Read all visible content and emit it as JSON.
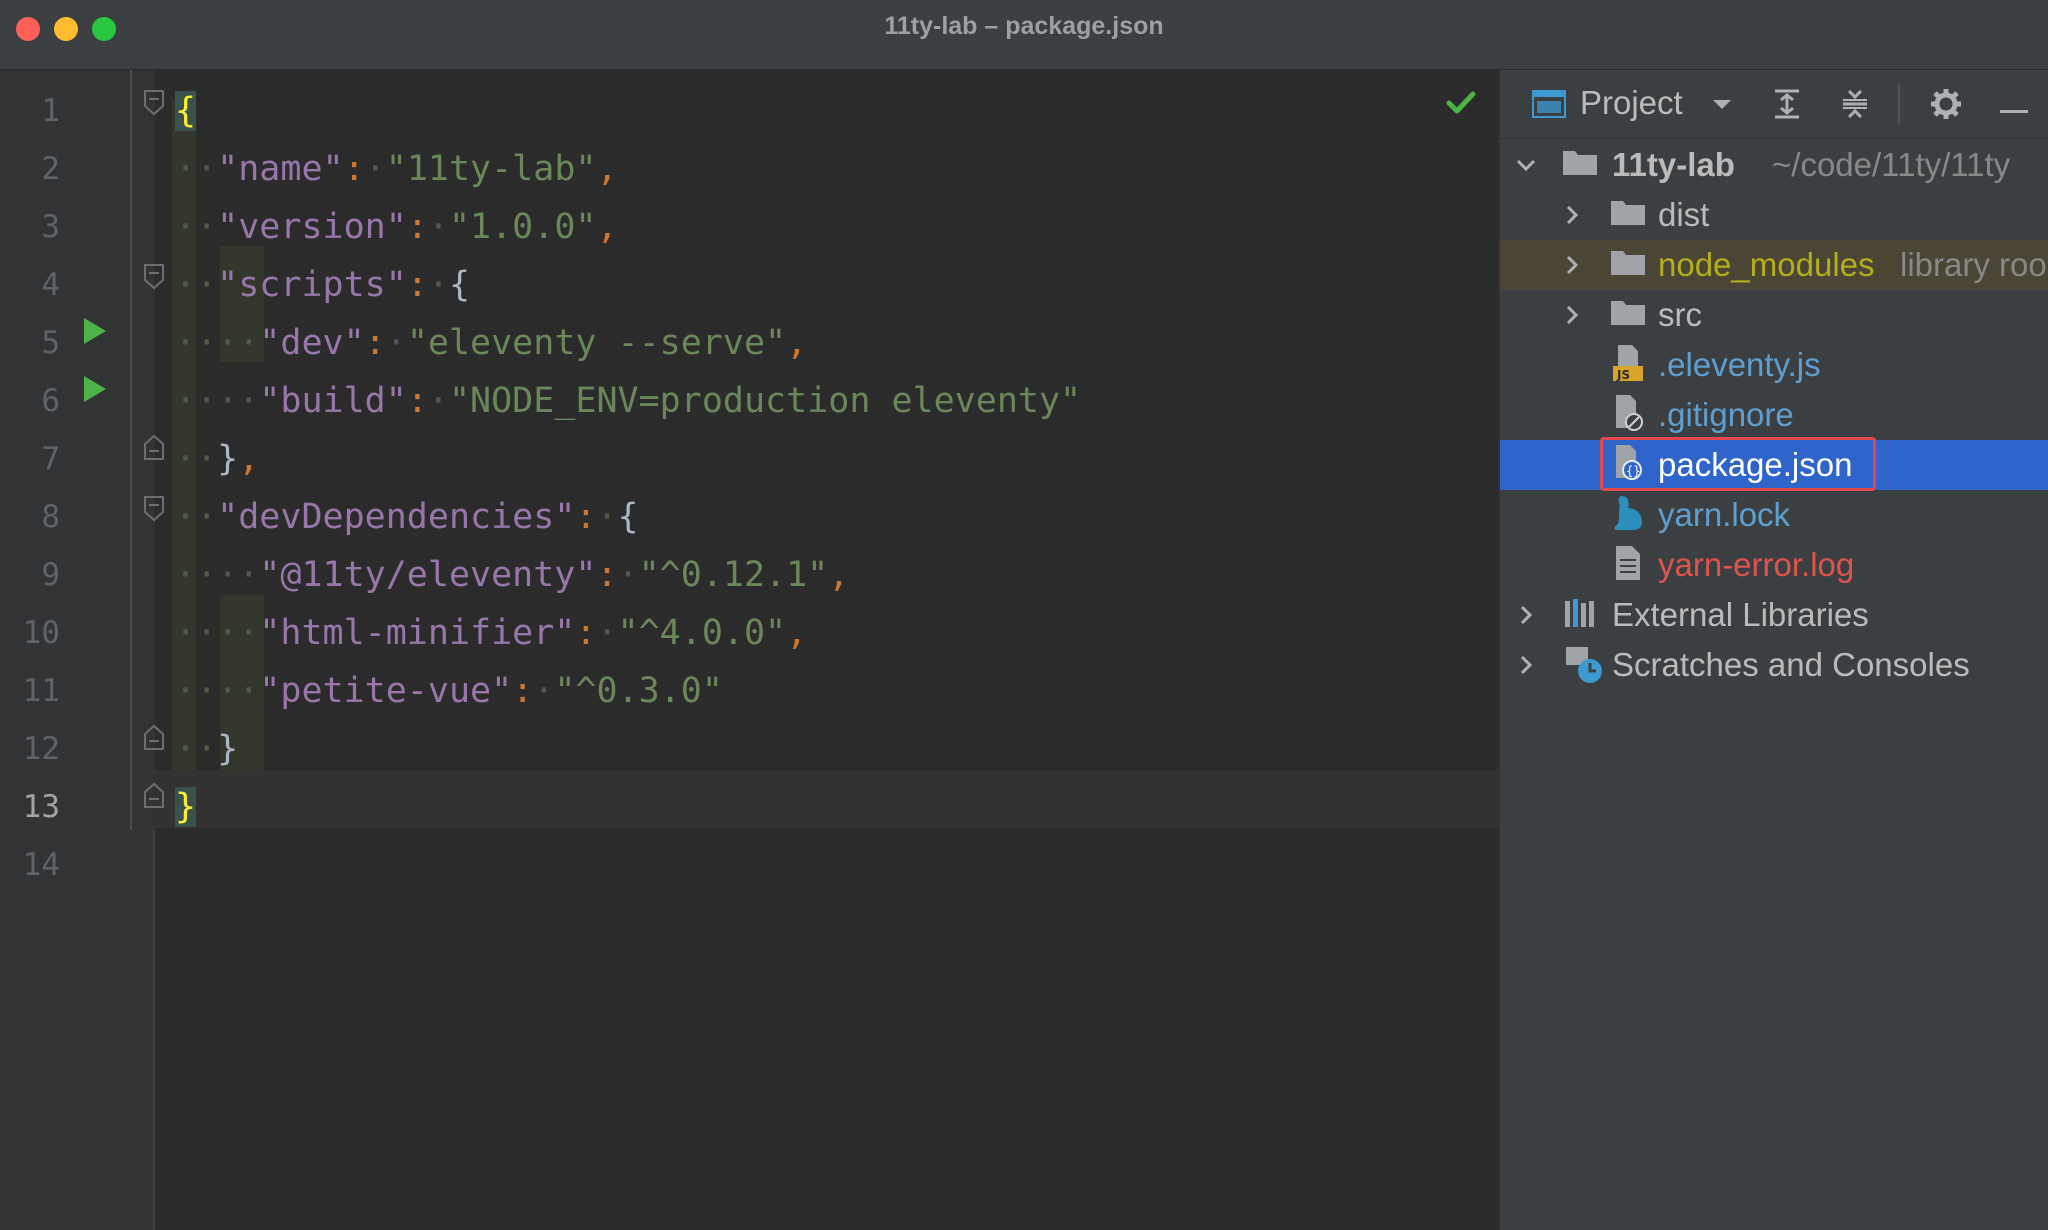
{
  "window": {
    "title": "11ty-lab – package.json"
  },
  "editor": {
    "line_numbers": [
      "1",
      "2",
      "3",
      "4",
      "5",
      "6",
      "7",
      "8",
      "9",
      "10",
      "11",
      "12",
      "13",
      "14"
    ],
    "current_line": "13",
    "code": {
      "l1": {
        "open": "{"
      },
      "l2": {
        "key": "\"name\"",
        "colon": ":",
        "value": "\"11ty-lab\"",
        "comma": ","
      },
      "l3": {
        "key": "\"version\"",
        "colon": ":",
        "value": "\"1.0.0\"",
        "comma": ","
      },
      "l4": {
        "key": "\"scripts\"",
        "colon": ":",
        "open": "{"
      },
      "l5": {
        "key": "\"dev\"",
        "colon": ":",
        "value": "\"eleventy --serve\"",
        "comma": ","
      },
      "l6": {
        "key": "\"build\"",
        "colon": ":",
        "value": "\"NODE_ENV=production eleventy\""
      },
      "l7": {
        "close": "}",
        "comma": ","
      },
      "l8": {
        "key": "\"devDependencies\"",
        "colon": ":",
        "open": "{"
      },
      "l9": {
        "key": "\"@11ty/eleventy\"",
        "colon": ":",
        "value": "\"^0.12.1\"",
        "comma": ","
      },
      "l10": {
        "key": "\"html-minifier\"",
        "colon": ":",
        "value": "\"^4.0.0\"",
        "comma": ","
      },
      "l11": {
        "key": "\"petite-vue\"",
        "colon": ":",
        "value": "\"^0.3.0\""
      },
      "l12": {
        "close": "}"
      },
      "l13": {
        "close": "}"
      }
    }
  },
  "project": {
    "header_label": "Project",
    "root": {
      "name": "11ty-lab",
      "path": "~/code/11ty/11ty"
    },
    "items": [
      {
        "name": "dist",
        "kind": "folder"
      },
      {
        "name": "node_modules",
        "hint": "library roo",
        "kind": "folder"
      },
      {
        "name": "src",
        "kind": "folder"
      },
      {
        "name": ".eleventy.js",
        "kind": "js-file"
      },
      {
        "name": ".gitignore",
        "kind": "ignore-file"
      },
      {
        "name": "package.json",
        "kind": "json-file",
        "selected": true
      },
      {
        "name": "yarn.lock",
        "kind": "yarn-file"
      },
      {
        "name": "yarn-error.log",
        "kind": "log-file"
      }
    ],
    "external_libraries": "External Libraries",
    "scratches": "Scratches and Consoles"
  },
  "colors": {
    "key": "#9876aa",
    "string": "#6a8759",
    "punct": "#cc7832",
    "selection": "#2f65ca",
    "highlight_box": "#e4474b",
    "run_icon": "#4db346"
  }
}
